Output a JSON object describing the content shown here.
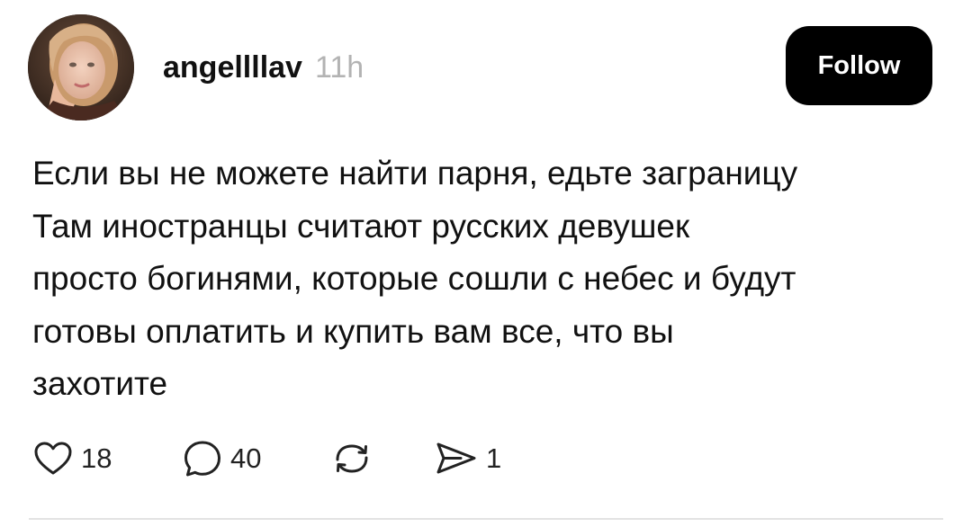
{
  "post": {
    "username": "angellllav",
    "timestamp": "11h",
    "follow_label": "Follow",
    "text_lines": [
      "Если вы не можете найти парня, едьте заграницу",
      "Там иностранцы считают русских девушек",
      "просто богинями, которые сошли с небес и будут",
      "готовы оплатить и купить вам все, что вы",
      "захотите"
    ],
    "actions": {
      "likes": {
        "icon": "heart-icon",
        "count": "18"
      },
      "replies": {
        "icon": "comment-bubble-icon",
        "count": "40"
      },
      "reposts": {
        "icon": "repost-icon",
        "count": ""
      },
      "shares": {
        "icon": "send-icon",
        "count": "1"
      }
    }
  },
  "colors": {
    "button_bg": "#000000",
    "button_text": "#ffffff",
    "timestamp": "#b3b3b3",
    "divider": "#e3e3e3"
  }
}
